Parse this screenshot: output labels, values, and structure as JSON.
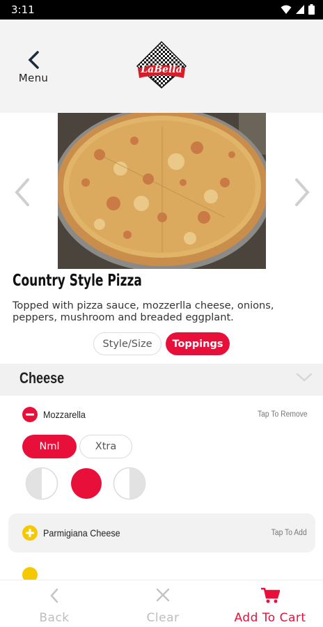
{
  "status_bar": {
    "time": "3:11"
  },
  "header": {
    "back_label": "Menu",
    "logo_text": "LaBella"
  },
  "item": {
    "title": "Country Style Pizza",
    "description": "Topped with pizza sauce, mozzerlla cheese, onions, peppers, mushroom and breaded eggplant."
  },
  "tabs": [
    {
      "label": "Style/Size",
      "active": false
    },
    {
      "label": "Toppings",
      "active": true
    }
  ],
  "section": {
    "title": "Cheese"
  },
  "toppings": [
    {
      "name": "Mozzarella",
      "hint": "Tap To Remove",
      "selected": true
    },
    {
      "name": "Parmigiana Cheese",
      "hint": "Tap To Add",
      "selected": false
    }
  ],
  "amount_options": [
    "Nml",
    "Xtra"
  ],
  "selected_amount": "Nml",
  "selected_portion": "whole",
  "footer": {
    "back": "Back",
    "clear": "Clear",
    "add_to_cart": "Add To Cart"
  },
  "colors": {
    "accent": "#e8103a",
    "add_yellow": "#f5c800",
    "disabled": "#bdbdbd"
  }
}
